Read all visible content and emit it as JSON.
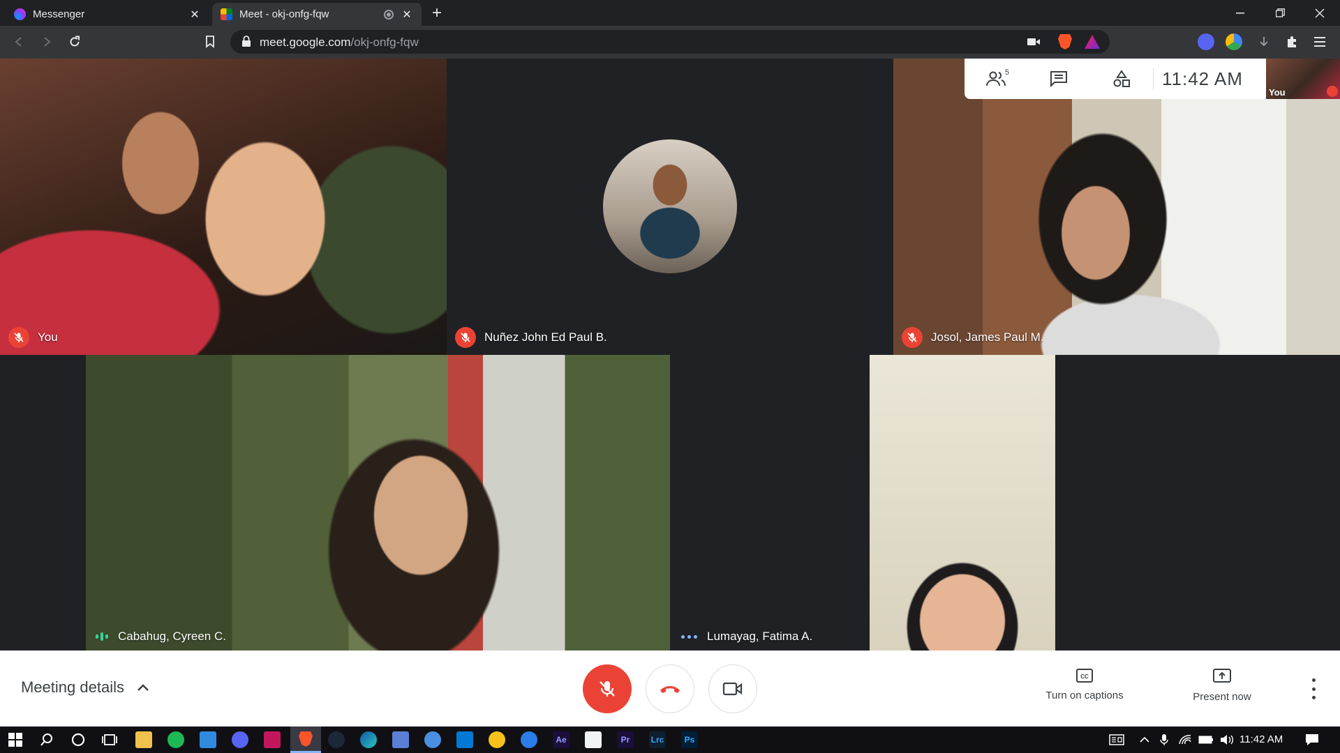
{
  "browser": {
    "tabs": [
      {
        "title": "Messenger",
        "active": false
      },
      {
        "title": "Meet - okj-onfg-fqw",
        "active": true
      }
    ],
    "new_tab_glyph": "+",
    "close_glyph": "✕",
    "url_host": "meet.google.com",
    "url_path": "/okj-onfg-fqw"
  },
  "info_panel": {
    "participant_count": "5",
    "time": "11:42 AM",
    "self_label": "You"
  },
  "participants": [
    {
      "name": "You",
      "status": "muted"
    },
    {
      "name": "Nuñez John Ed Paul B.",
      "status": "muted"
    },
    {
      "name": "Josol, James Paul M.",
      "status": "muted"
    },
    {
      "name": "Cabahug, Cyreen C.",
      "status": "speaking"
    },
    {
      "name": "Lumayag, Fatima A.",
      "status": "connecting"
    }
  ],
  "bottom_bar": {
    "meeting_details": "Meeting details",
    "captions_label": "Turn on captions",
    "present_label": "Present now"
  },
  "taskbar": {
    "time": "11:42 AM",
    "app_labels": [
      "Ae",
      "Pr",
      "Lrc",
      "Ps"
    ]
  },
  "colors": {
    "end_call": "#ea4335",
    "mic_off": "#ea4335",
    "speaking": "#34d399",
    "stage_bg": "#202124"
  }
}
